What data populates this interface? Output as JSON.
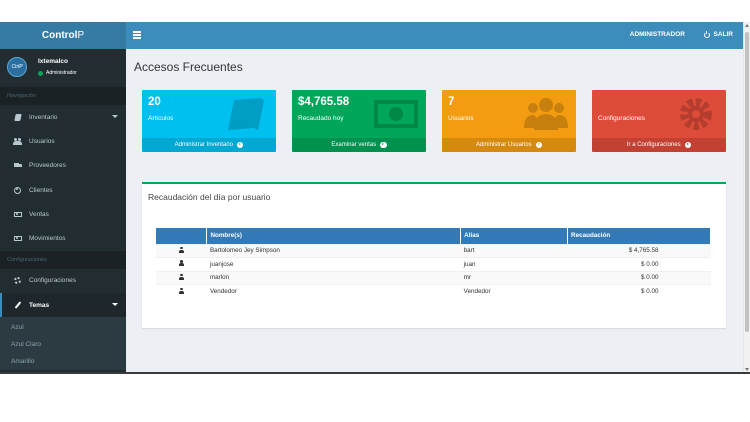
{
  "app": {
    "logo_bold": "Control",
    "logo_light": "P"
  },
  "navbar": {
    "user_label": "ADMINISTRADOR",
    "exit_label": "SALIR"
  },
  "user_panel": {
    "avatar_text": "CtrlP",
    "name": "Ixtemalco",
    "role": "Administrador",
    "status_color": "#00a65a"
  },
  "sidebar": {
    "header_nav": "Navegación",
    "header_config": "Configuraciones",
    "items": [
      {
        "label": "Inventario",
        "icon": "book-icon"
      },
      {
        "label": "Usuarios",
        "icon": "users-icon"
      },
      {
        "label": "Proveedores",
        "icon": "truck-icon"
      },
      {
        "label": "Clientes",
        "icon": "user-circle-icon"
      },
      {
        "label": "Ventas",
        "icon": "money-icon"
      },
      {
        "label": "Movimientos",
        "icon": "money-icon"
      }
    ],
    "config_items": [
      {
        "label": "Configuraciones",
        "icon": "cogs-icon"
      },
      {
        "label": "Temas",
        "icon": "paint-brush-icon"
      }
    ],
    "themes": [
      "Azul",
      "Azul Claro",
      "Amarillo"
    ]
  },
  "page": {
    "title": "Accesos Frecuentes"
  },
  "boxes": [
    {
      "value": "20",
      "label": "Artículos",
      "footer": "Administrar Inventario",
      "color": "#00c0ef",
      "icon": "book-icon"
    },
    {
      "value": "$4,765.58",
      "label": "Recaudado hoy",
      "footer": "Examinar ventas",
      "color": "#00a65a",
      "icon": "money-icon"
    },
    {
      "value": "7",
      "label": "Usuarios",
      "footer": "Administrar Usuarios",
      "color": "#f39c12",
      "icon": "users-icon"
    },
    {
      "value": "",
      "label": "Configuraciones",
      "footer": "Ir a Configuraciones",
      "color": "#dd4b39",
      "icon": "cogs-icon"
    }
  ],
  "panel": {
    "title": "Recaudación del día por usuario",
    "columns": [
      "",
      "Nombre(s)",
      "Alias",
      "Recaudación"
    ],
    "rows": [
      {
        "name": "Bartolomeo Jey Simpson",
        "alias": "bart",
        "amount": "$ 4,765.58"
      },
      {
        "name": "juanjose",
        "alias": "juan",
        "amount": "$ 0.00"
      },
      {
        "name": "marlon",
        "alias": "mr",
        "amount": "$ 0.00"
      },
      {
        "name": "Vendedor",
        "alias": "Vendedor",
        "amount": "$ 0.00"
      }
    ]
  }
}
